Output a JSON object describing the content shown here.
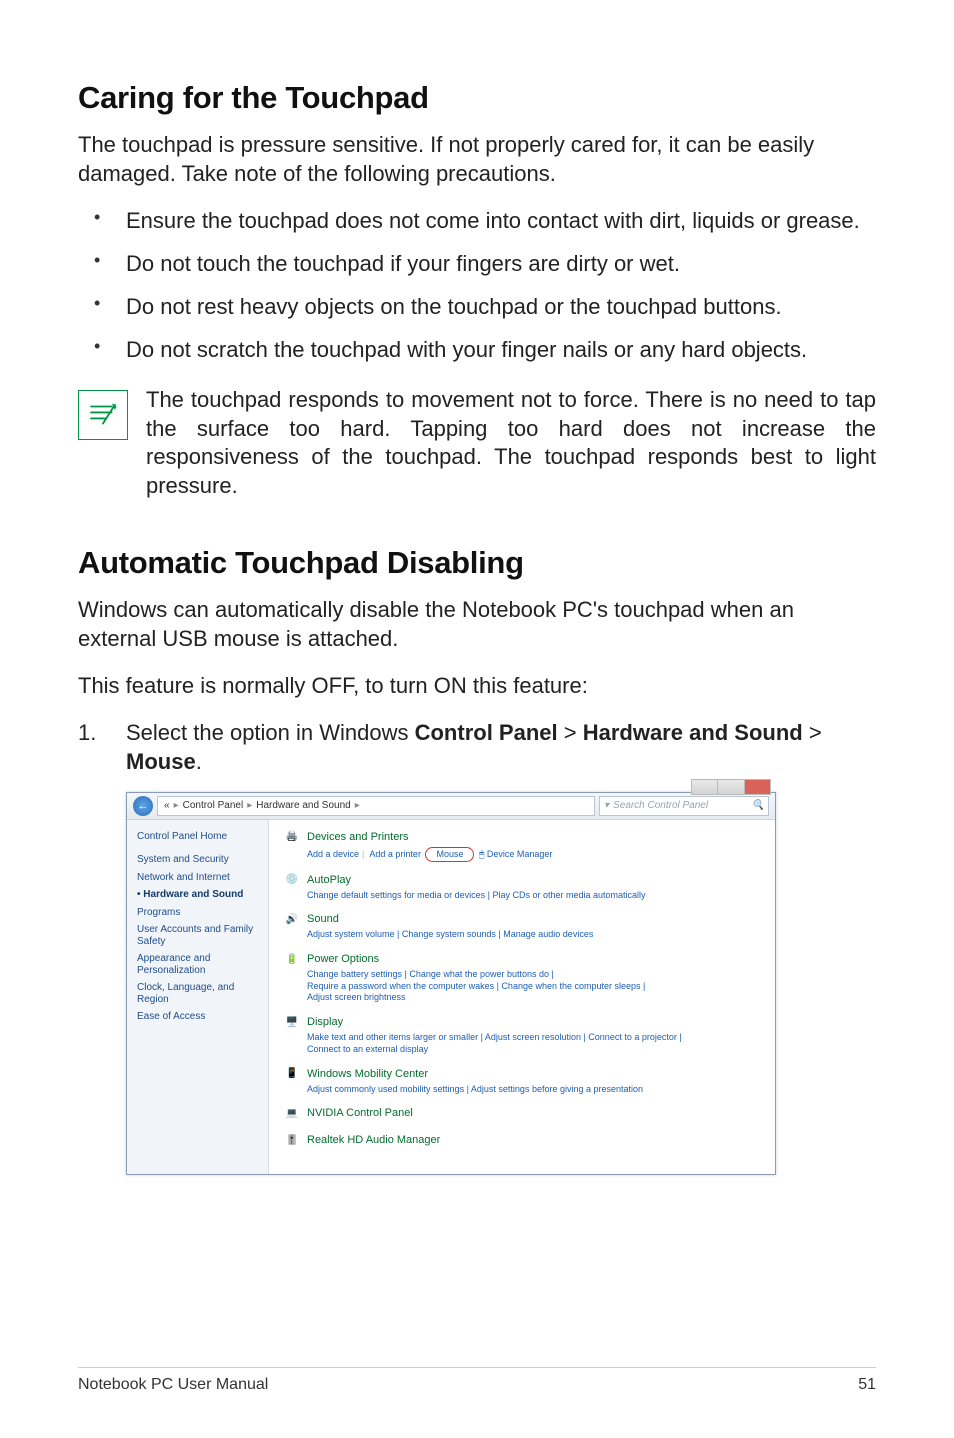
{
  "section1": {
    "heading": "Caring for the Touchpad",
    "intro": "The touchpad is pressure sensitive. If not properly cared for, it can be easily damaged. Take note of the following precautions.",
    "bullets": [
      "Ensure the touchpad does not come into contact with dirt, liquids or grease.",
      "Do not touch the touchpad if your fingers are dirty or wet.",
      "Do not rest heavy objects on the touchpad or the touchpad buttons.",
      "Do not scratch the touchpad with your finger nails or any hard objects."
    ],
    "note": "The touchpad responds to movement not to force. There is no need to tap the surface too hard. Tapping too hard does not increase the responsiveness of the touchpad. The touchpad responds best to light pressure."
  },
  "section2": {
    "heading": "Automatic Touchpad Disabling",
    "para1": "Windows can automatically disable the Notebook PC's touchpad when an external USB mouse is attached.",
    "para2": "This feature is normally OFF, to turn ON this feature:",
    "step1_prefix": "Select the option in Windows ",
    "step1_b1": "Control Panel",
    "step1_gt1": " > ",
    "step1_b2": "Hardware and Sound",
    "step1_gt2": " > ",
    "step1_b3": "Mouse",
    "step1_suffix": "."
  },
  "screenshot": {
    "breadcrumb": {
      "root_icon": "«",
      "items": [
        "Control Panel",
        "Hardware and Sound"
      ]
    },
    "search_placeholder": "Search Control Panel",
    "sidebar": [
      "Control Panel Home",
      "System and Security",
      "Network and Internet",
      "Hardware and Sound",
      "Programs",
      "User Accounts and Family Safety",
      "Appearance and Personalization",
      "Clock, Language, and Region",
      "Ease of Access"
    ],
    "categories": {
      "devices": {
        "title": "Devices and Printers",
        "links": {
          "a": "Add a device",
          "b": "Add a printer",
          "mouse": "Mouse",
          "dm": "Device Manager"
        }
      },
      "autoplay": {
        "title": "AutoPlay",
        "sub": "Change default settings for media or devices   |   Play CDs or other media automatically"
      },
      "sound": {
        "title": "Sound",
        "sub": "Adjust system volume   |   Change system sounds   |   Manage audio devices"
      },
      "power": {
        "title": "Power Options",
        "sub1": "Change battery settings   |   Change what the power buttons do   |",
        "sub2": "Require a password when the computer wakes   |   Change when the computer sleeps   |",
        "sub3": "Adjust screen brightness"
      },
      "display": {
        "title": "Display",
        "sub1": "Make text and other items larger or smaller   |   Adjust screen resolution   |   Connect to a projector   |",
        "sub2": "Connect to an external display"
      },
      "mobility": {
        "title": "Windows Mobility Center",
        "sub": "Adjust commonly used mobility settings   |   Adjust settings before giving a presentation"
      },
      "nvidia": {
        "title": "NVIDIA Control Panel"
      },
      "realtek": {
        "title": "Realtek HD Audio Manager"
      }
    }
  },
  "footer": {
    "left": "Notebook PC User Manual",
    "right": "51"
  }
}
